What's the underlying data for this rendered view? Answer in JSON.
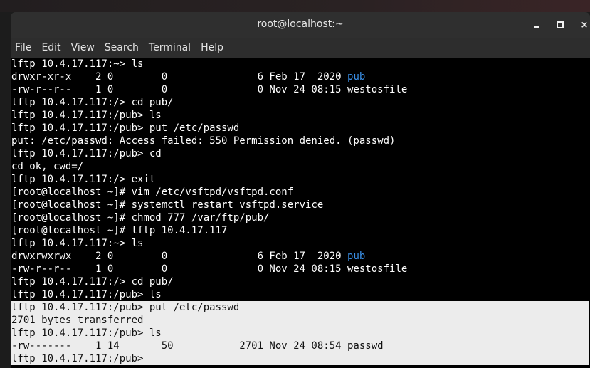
{
  "window": {
    "title": "root@localhost:~",
    "controls": {
      "minimize": "minimize",
      "maximize": "maximize",
      "close": "×"
    }
  },
  "menu": {
    "items": [
      "File",
      "Edit",
      "View",
      "Search",
      "Terminal",
      "Help"
    ]
  },
  "terminal": {
    "lines": [
      {
        "text": "lftp 10.4.17.117:~> ls",
        "highlight": false
      },
      {
        "text": "drwxr-xr-x    2 0        0               6 Feb 17  2020 ",
        "link": "pub",
        "highlight": false
      },
      {
        "text": "-rw-r--r--    1 0        0               0 Nov 24 08:15 westosfile",
        "highlight": false
      },
      {
        "text": "lftp 10.4.17.117:/> cd pub/",
        "highlight": false
      },
      {
        "text": "lftp 10.4.17.117:/pub> ls",
        "highlight": false
      },
      {
        "text": "lftp 10.4.17.117:/pub> put /etc/passwd",
        "highlight": false
      },
      {
        "text": "put: /etc/passwd: Access failed: 550 Permission denied. (passwd)",
        "highlight": false
      },
      {
        "text": "lftp 10.4.17.117:/pub> cd",
        "highlight": false
      },
      {
        "text": "cd ok, cwd=/",
        "highlight": false
      },
      {
        "text": "lftp 10.4.17.117:/> exit",
        "highlight": false
      },
      {
        "text": "[root@localhost ~]# vim /etc/vsftpd/vsftpd.conf",
        "highlight": false
      },
      {
        "text": "[root@localhost ~]# systemctl restart vsftpd.service",
        "highlight": false
      },
      {
        "text": "[root@localhost ~]# chmod 777 /var/ftp/pub/",
        "highlight": false
      },
      {
        "text": "[root@localhost ~]# lftp 10.4.17.117",
        "highlight": false
      },
      {
        "text": "lftp 10.4.17.117:~> ls",
        "highlight": false
      },
      {
        "text": "drwxrwxrwx    2 0        0               6 Feb 17  2020 ",
        "link": "pub",
        "highlight": false
      },
      {
        "text": "-rw-r--r--    1 0        0               0 Nov 24 08:15 westosfile",
        "highlight": false
      },
      {
        "text": "lftp 10.4.17.117:/> cd pub/",
        "highlight": false
      },
      {
        "text": "lftp 10.4.17.117:/pub> ls",
        "highlight": false
      },
      {
        "text": "lftp 10.4.17.117:/pub> put /etc/passwd",
        "highlight": true
      },
      {
        "text": "2701 bytes transferred",
        "highlight": true
      },
      {
        "text": "lftp 10.4.17.117:/pub> ls",
        "highlight": true
      },
      {
        "text": "-rw-------    1 14       50           2701 Nov 24 08:54 passwd",
        "highlight": true
      },
      {
        "text": "lftp 10.4.17.117:/pub>",
        "highlight": true
      }
    ]
  },
  "colors": {
    "terminal_bg": "#000000",
    "terminal_fg": "#ffffff",
    "link": "#3a8fe6",
    "selection_bg": "#ececec",
    "selection_fg": "#111111",
    "titlebar_bg": "#2f2f2f"
  }
}
